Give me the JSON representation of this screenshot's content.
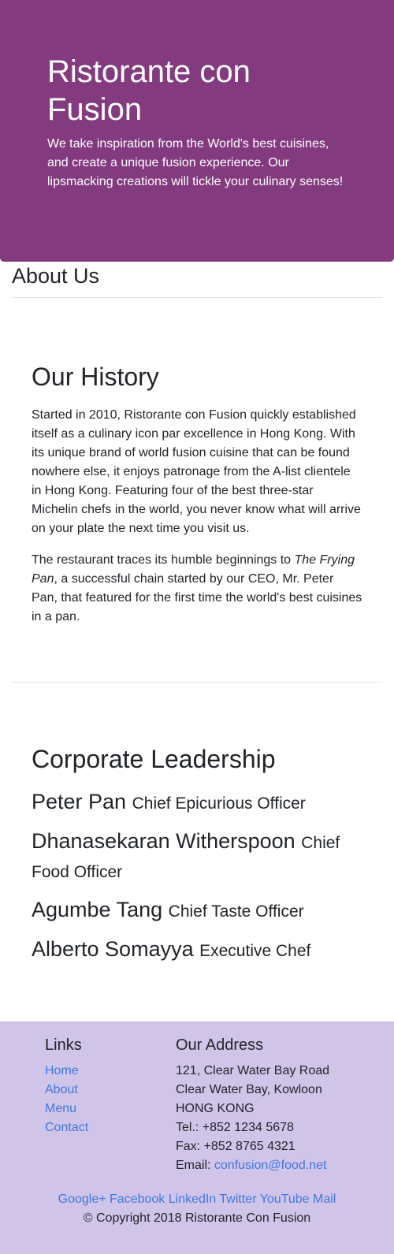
{
  "hero": {
    "title": "Ristorante con Fusion",
    "subtitle": "We take inspiration from the World's best cuisines, and create a unique fusion experience. Our lipsmacking creations will tickle your culinary senses!"
  },
  "about": {
    "title": "About Us"
  },
  "history": {
    "title": "Our History",
    "para1": "Started in 2010, Ristorante con Fusion quickly established itself as a culinary icon par excellence in Hong Kong. With its unique brand of world fusion cuisine that can be found nowhere else, it enjoys patronage from the A-list clientele in Hong Kong. Featuring four of the best three-star Michelin chefs in the world, you never know what will arrive on your plate the next time you visit us.",
    "para2_before": "The restaurant traces its humble beginnings to ",
    "para2_italic": "The Frying Pan",
    "para2_after": ", a successful chain started by our CEO, Mr. Peter Pan, that featured for the first time the world's best cuisines in a pan."
  },
  "leadership": {
    "title": "Corporate Leadership",
    "leaders": [
      {
        "name": "Peter Pan",
        "designation": "Chief Epicurious Officer"
      },
      {
        "name": "Dhanasekaran Witherspoon",
        "designation": "Chief Food Officer"
      },
      {
        "name": "Agumbe Tang",
        "designation": "Chief Taste Officer"
      },
      {
        "name": "Alberto Somayya",
        "designation": "Executive Chef"
      }
    ]
  },
  "footer": {
    "links_title": "Links",
    "links": [
      "Home",
      "About",
      "Menu",
      "Contact"
    ],
    "address_title": "Our Address",
    "address_lines": [
      "121, Clear Water Bay Road",
      "Clear Water Bay, Kowloon",
      "HONG KONG",
      "Tel.: +852 1234 5678",
      "Fax: +852 8765 4321"
    ],
    "email_label": "Email: ",
    "email": "confusion@food.net",
    "social": [
      "Google+",
      "Facebook",
      "LinkedIn",
      "Twitter",
      "YouTube",
      "Mail"
    ],
    "copyright": "© Copyright 2018 Ristorante Con Fusion"
  },
  "colors": {
    "hero_bg": "#833a7f",
    "footer_bg": "#d1c4e9",
    "link": "#3f78e0"
  }
}
